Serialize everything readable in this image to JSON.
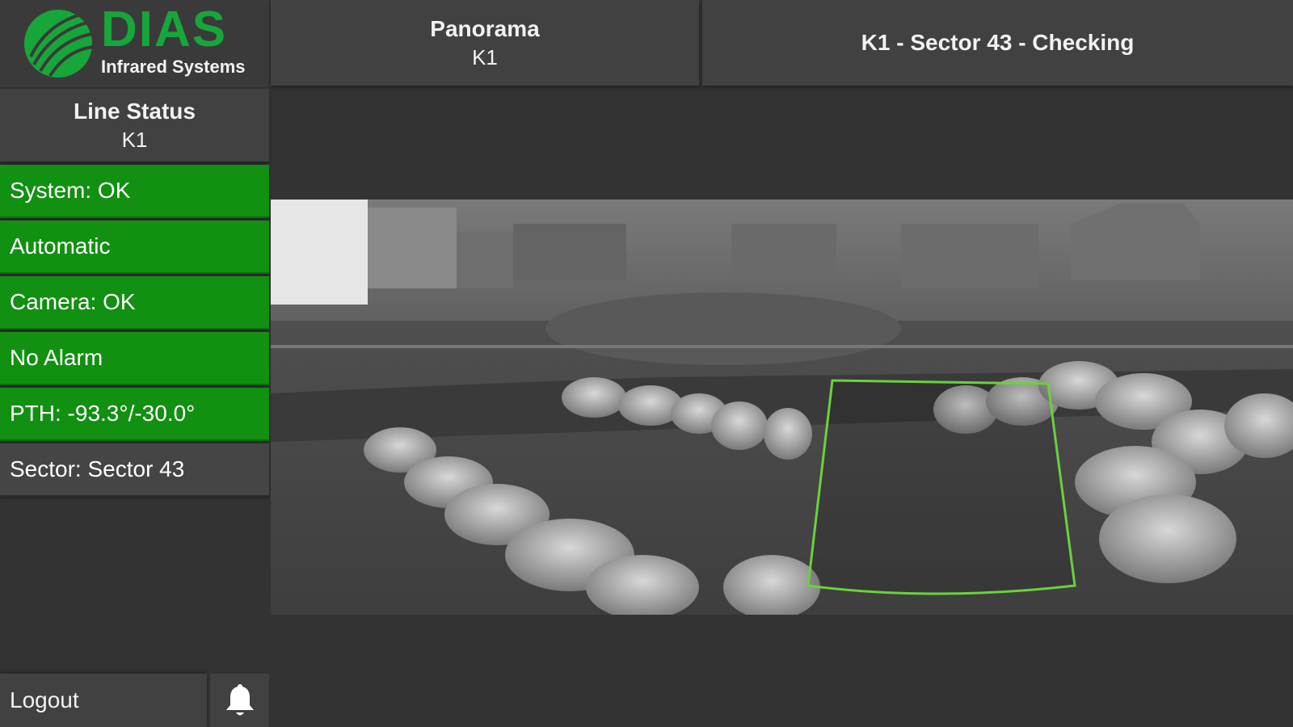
{
  "logo": {
    "brand": "DIAS",
    "subtitle": "Infrared Systems",
    "brand_color": "#17a63a"
  },
  "header": {
    "view_title": "Panorama",
    "view_line": "K1",
    "sector_status": "K1 - Sector 43 - Checking"
  },
  "sidebar": {
    "line_status_title": "Line Status",
    "line_status_line": "K1",
    "items": [
      {
        "label": "System: OK",
        "state": "ok"
      },
      {
        "label": "Automatic",
        "state": "ok"
      },
      {
        "label": "Camera: OK",
        "state": "ok"
      },
      {
        "label": "No Alarm",
        "state": "ok"
      },
      {
        "label": "PTH: -93.3°/-30.0°",
        "state": "ok"
      },
      {
        "label": "Sector: Sector 43",
        "state": "neutral"
      }
    ],
    "logout_label": "Logout",
    "bell_icon": "bell-icon"
  },
  "colors": {
    "ok_green": "#119011",
    "panel_gray": "#414141",
    "background": "#333333",
    "sector_outline": "#6ad23a"
  },
  "panorama": {
    "active_sector": "Sector 43",
    "image_type": "thermal infrared panorama"
  }
}
